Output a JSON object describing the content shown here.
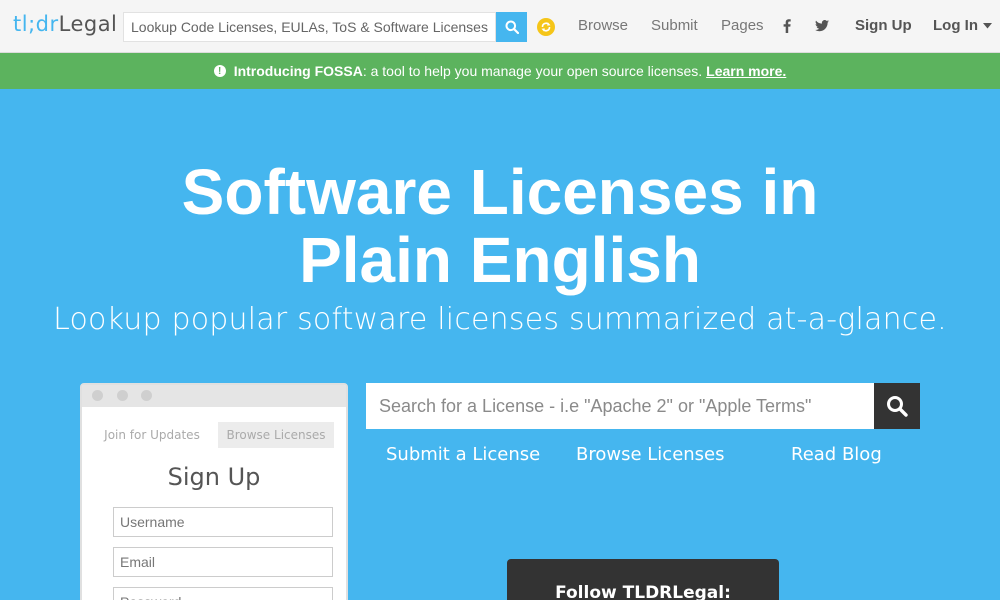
{
  "logo": {
    "part1": "tl;dr",
    "part2": "Legal"
  },
  "nav": {
    "search_placeholder": "Lookup Code Licenses, EULAs, ToS & Software Licenses",
    "browse": "Browse",
    "submit": "Submit",
    "pages": "Pages",
    "sign_up": "Sign Up",
    "log_in": "Log In"
  },
  "banner": {
    "product": "Introducing FOSSA",
    "text": ": a tool to help you manage your open source licenses.",
    "link": "Learn more."
  },
  "hero": {
    "title": "Software Licenses in Plain English",
    "subtitle": "Lookup popular software licenses summarized at-a-glance."
  },
  "signup_card": {
    "tab_join": "Join for Updates",
    "tab_browse": "Browse Licenses",
    "title": "Sign Up",
    "username_placeholder": "Username",
    "email_placeholder": "Email",
    "password_placeholder": "Password"
  },
  "main_search": {
    "placeholder": "Search for a License - i.e \"Apache 2\" or \"Apple Terms\""
  },
  "actions": {
    "submit": "Submit a License",
    "browse": "Browse Licenses",
    "blog": "Read Blog"
  },
  "follow": {
    "title": "Follow TLDRLegal:"
  },
  "colors": {
    "brand_blue": "#45b6ef",
    "banner_green": "#5cb35e",
    "dark": "#333333"
  }
}
